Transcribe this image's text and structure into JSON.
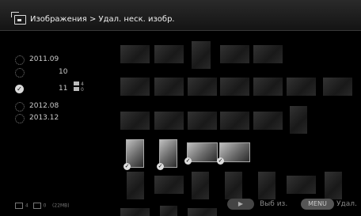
{
  "header": {
    "title": "Изображения > Удал. неск. изобр."
  },
  "dates": [
    {
      "label": "2011.09",
      "checked": false
    },
    {
      "label": "10",
      "checked": false
    },
    {
      "label": "11",
      "checked": true,
      "count_top": "4",
      "count_bottom": "0"
    },
    {
      "label": "2012.08",
      "checked": false
    },
    {
      "label": "2013.12",
      "checked": false
    }
  ],
  "footer": {
    "images_count": "4",
    "videos_count": "0",
    "size": "(22MB)",
    "play_icon": "play-icon",
    "select_label": "Выб из.",
    "menu_label": "MENU",
    "delete_label": "Удал."
  }
}
